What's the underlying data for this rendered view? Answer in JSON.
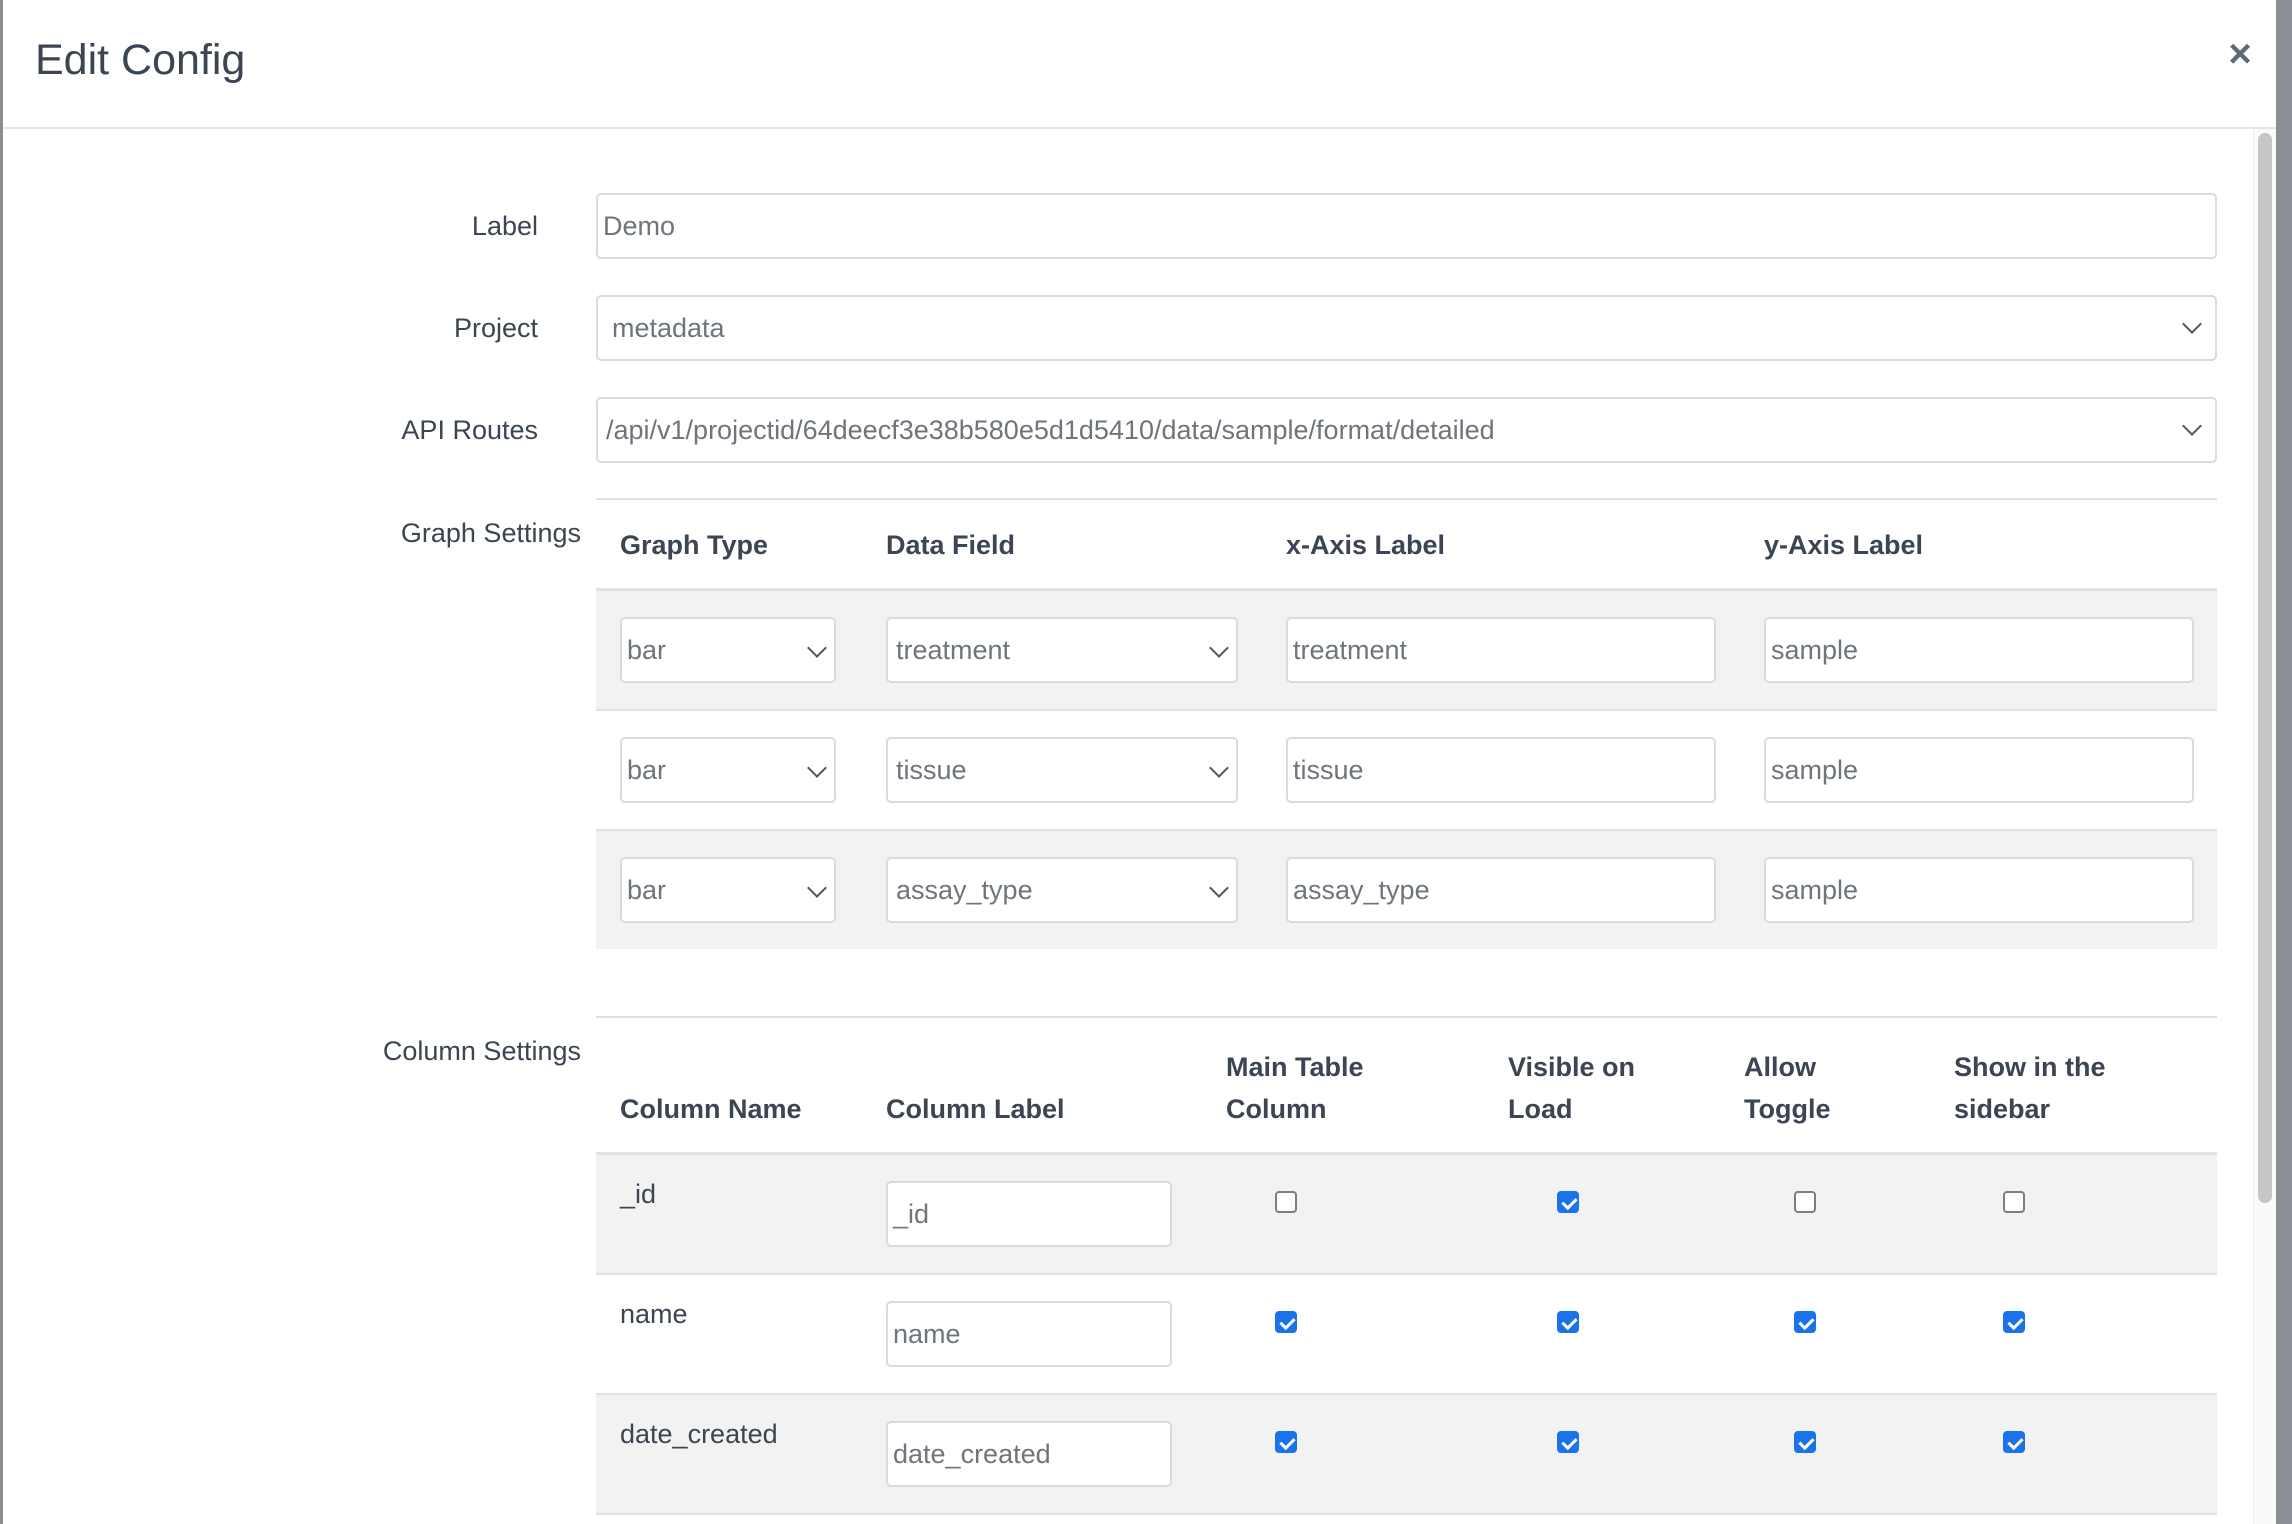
{
  "modal": {
    "title": "Edit Config",
    "close_glyph": "×"
  },
  "form": {
    "label": {
      "label": "Label",
      "value": "Demo"
    },
    "project": {
      "label": "Project",
      "value": "metadata"
    },
    "api_routes": {
      "label": "API Routes",
      "value": "/api/v1/projectid/64deecf3e38b580e5d1d5410/data/sample/format/detailed"
    }
  },
  "graph_settings": {
    "label": "Graph Settings",
    "headers": [
      "Graph Type",
      "Data Field",
      "x-Axis Label",
      "y-Axis Label"
    ],
    "rows": [
      {
        "graph_type": "bar",
        "data_field": "treatment",
        "x_label": "treatment",
        "y_label": "sample"
      },
      {
        "graph_type": "bar",
        "data_field": "tissue",
        "x_label": "tissue",
        "y_label": "sample"
      },
      {
        "graph_type": "bar",
        "data_field": "assay_type",
        "x_label": "assay_type",
        "y_label": "sample"
      }
    ]
  },
  "column_settings": {
    "label": "Column Settings",
    "headers": {
      "column_name": "Column Name",
      "column_label": "Column Label",
      "main_table_l1": "Main Table",
      "main_table_l2": "Column",
      "visible_l1": "Visible on",
      "visible_l2": "Load",
      "toggle_l1": "Allow",
      "toggle_l2": "Toggle",
      "sidebar_l1": "Show in the",
      "sidebar_l2": "sidebar"
    },
    "rows": [
      {
        "name": "_id",
        "label": "_id",
        "main": false,
        "visible": true,
        "toggle": false,
        "sidebar": false
      },
      {
        "name": "name",
        "label": "name",
        "main": true,
        "visible": true,
        "toggle": true,
        "sidebar": true
      },
      {
        "name": "date_created",
        "label": "date_created",
        "main": true,
        "visible": true,
        "toggle": true,
        "sidebar": true
      }
    ]
  },
  "colors": {
    "accent": "#1a73e8",
    "stripe": "#f2f2f2"
  }
}
